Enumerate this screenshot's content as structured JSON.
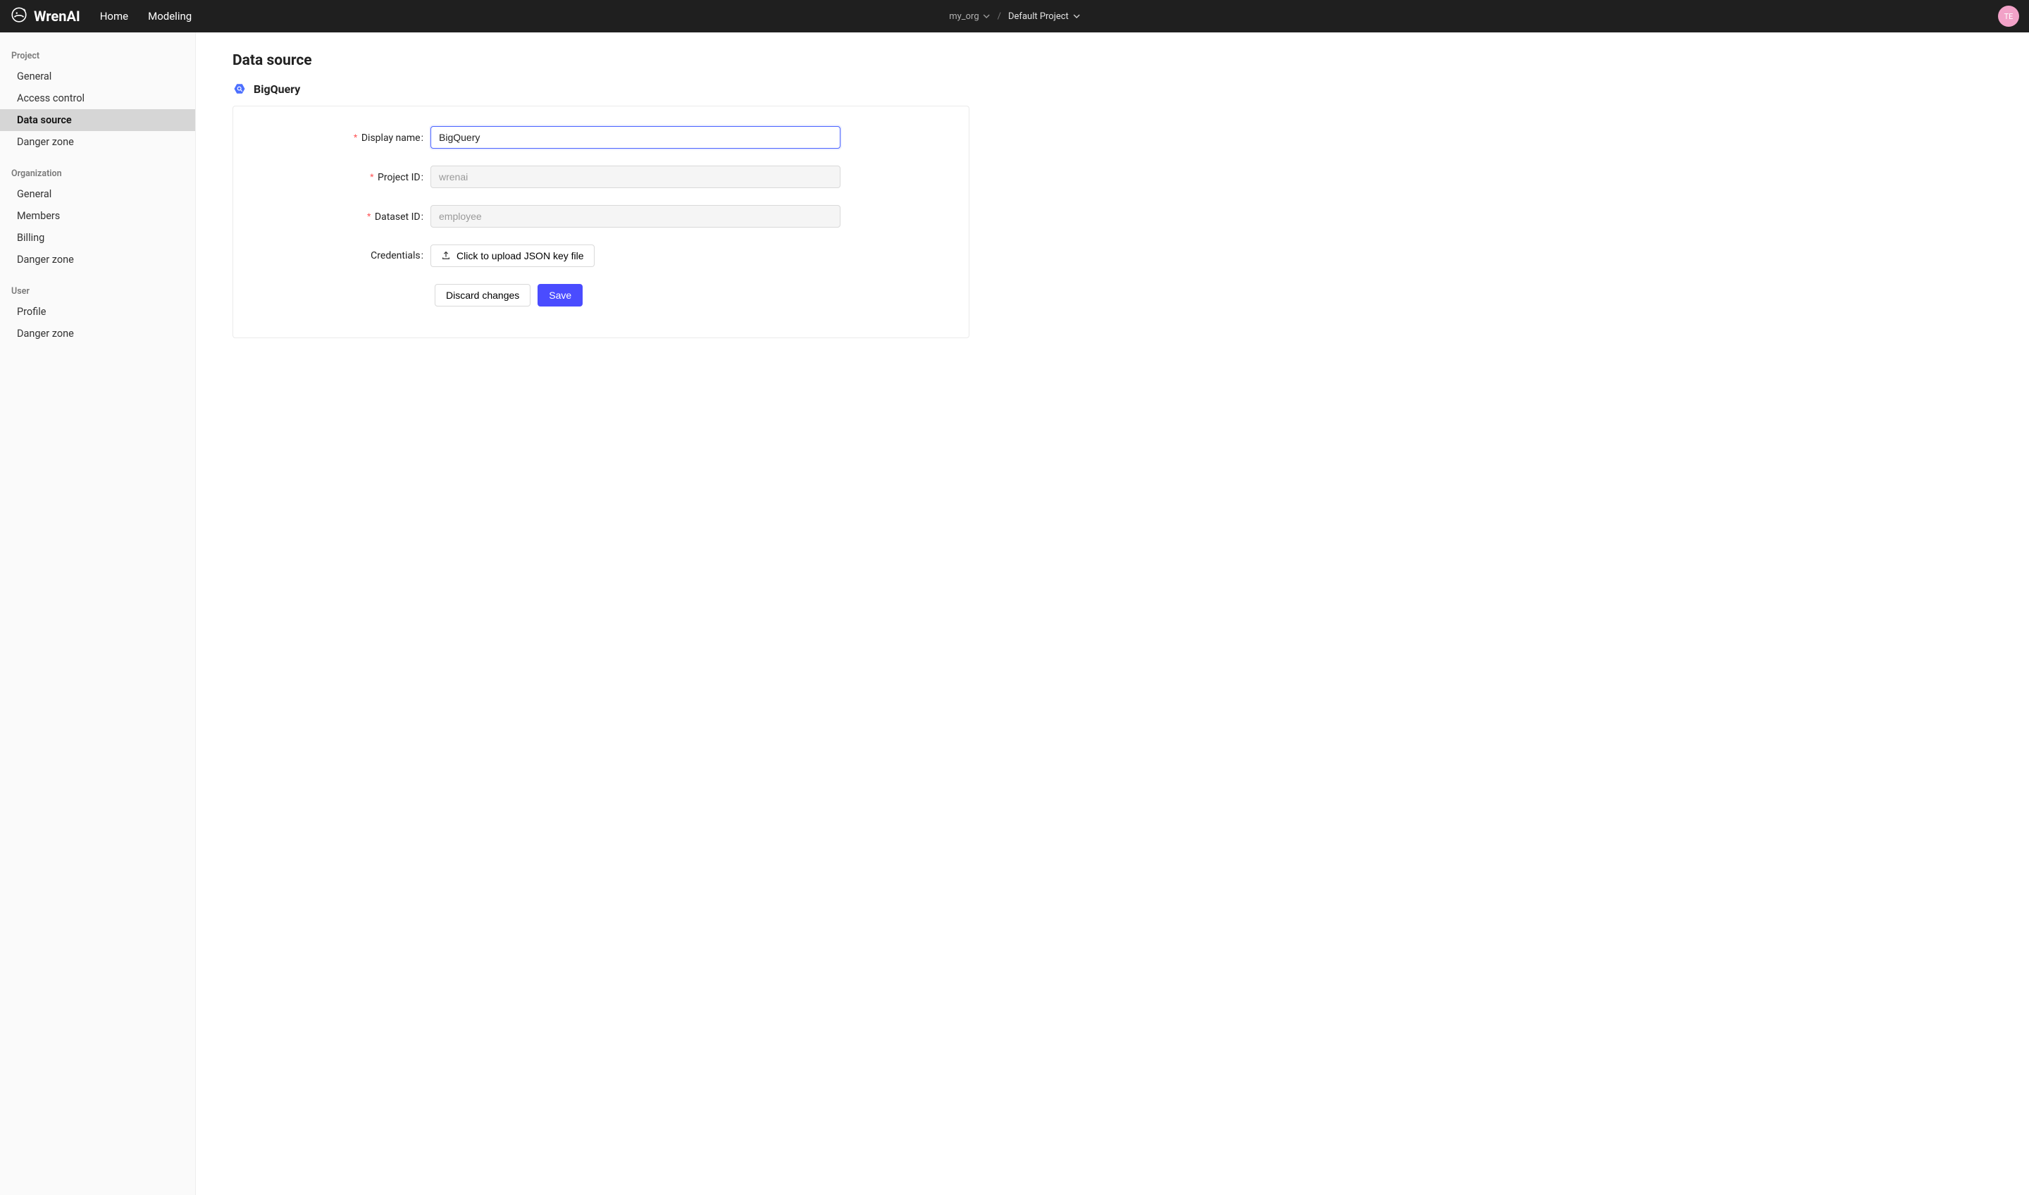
{
  "brand": "WrenAI",
  "nav": {
    "home": "Home",
    "modeling": "Modeling"
  },
  "crumb": {
    "org": "my_org",
    "project": "Default Project"
  },
  "avatar": "TE",
  "sidebar": {
    "project": {
      "heading": "Project",
      "items": [
        "General",
        "Access control",
        "Data source",
        "Danger zone"
      ],
      "activeIndex": 2
    },
    "organization": {
      "heading": "Organization",
      "items": [
        "General",
        "Members",
        "Billing",
        "Danger zone"
      ]
    },
    "user": {
      "heading": "User",
      "items": [
        "Profile",
        "Danger zone"
      ]
    }
  },
  "page": {
    "title": "Data source",
    "provider": "BigQuery"
  },
  "form": {
    "display_name": {
      "label": "Display name",
      "value": "BigQuery",
      "required": true
    },
    "project_id": {
      "label": "Project ID",
      "value": "wrenai",
      "required": true,
      "disabled": true
    },
    "dataset_id": {
      "label": "Dataset ID",
      "value": "employee",
      "required": true,
      "disabled": true
    },
    "credentials": {
      "label": "Credentials",
      "button": "Click to upload JSON key file"
    },
    "discard": "Discard changes",
    "save": "Save"
  }
}
